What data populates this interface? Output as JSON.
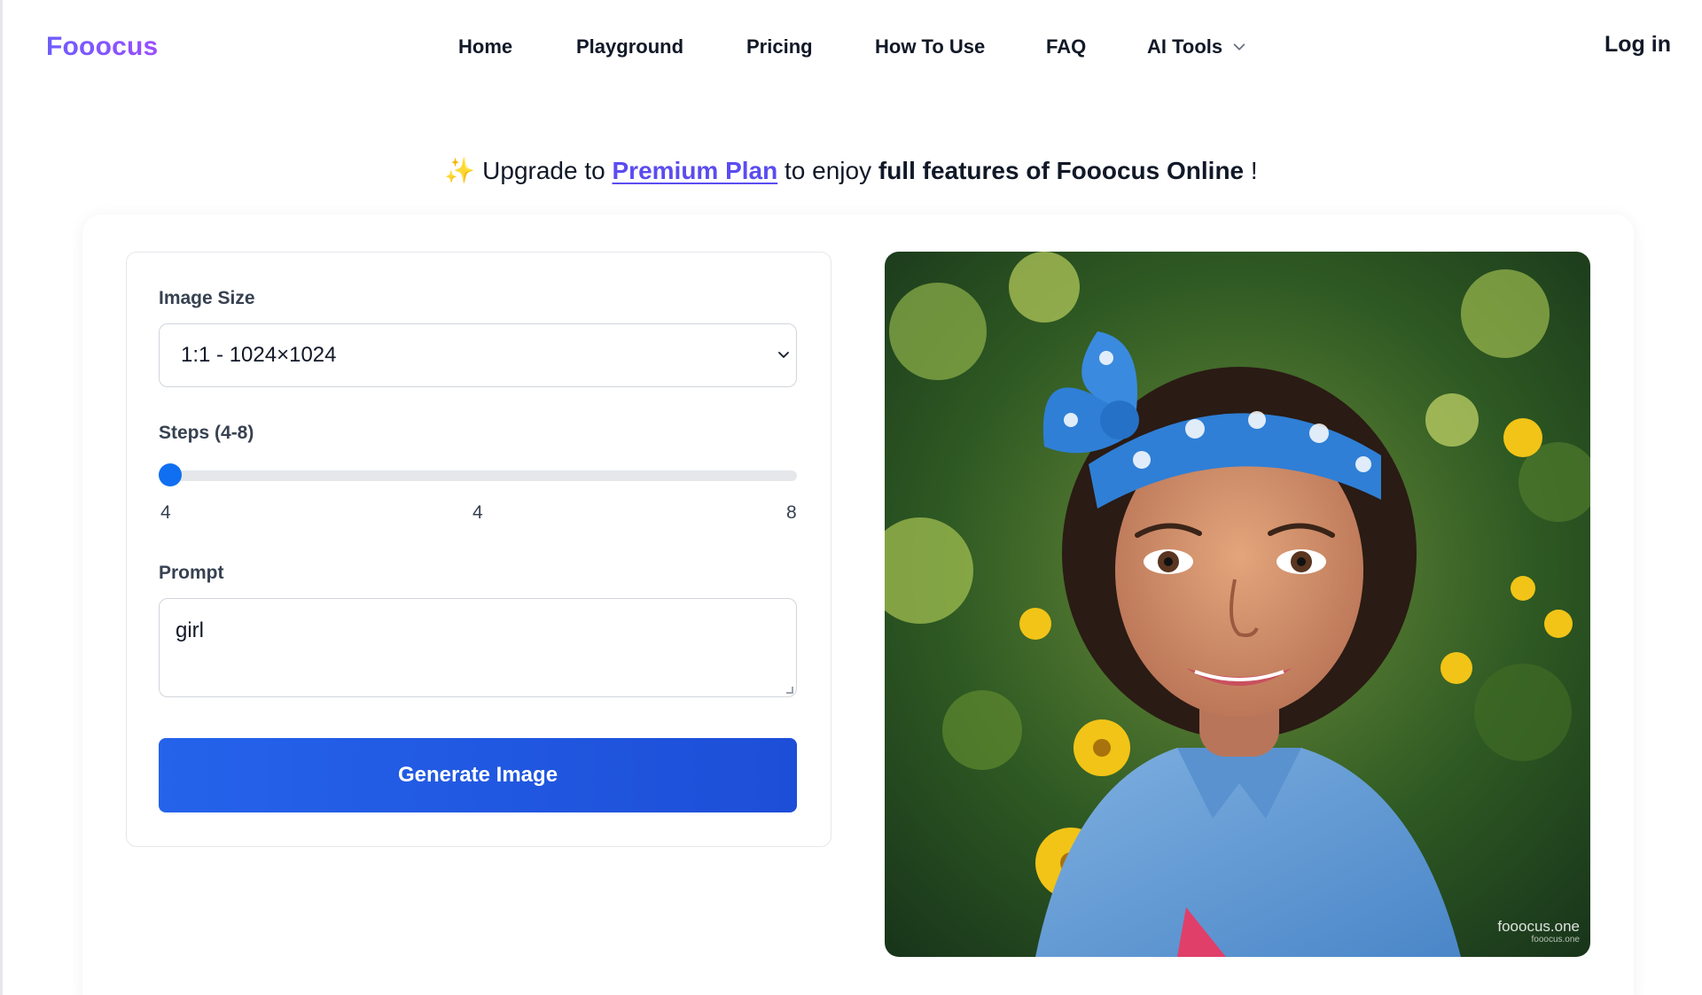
{
  "header": {
    "logo": "Fooocus",
    "nav": [
      {
        "label": "Home"
      },
      {
        "label": "Playground"
      },
      {
        "label": "Pricing"
      },
      {
        "label": "How To Use"
      },
      {
        "label": "FAQ"
      },
      {
        "label": "AI Tools"
      }
    ],
    "login": "Log in"
  },
  "banner": {
    "sparkle": "✨",
    "prefix": "Upgrade to",
    "link": "Premium Plan",
    "middle": "to enjoy",
    "bold": "full features of Fooocus Online",
    "suffix": "!"
  },
  "form": {
    "image_size_label": "Image Size",
    "image_size_value": "1:1 - 1024×1024",
    "steps_label": "Steps (4-8)",
    "steps_min": "4",
    "steps_value": "4",
    "steps_max": "8",
    "prompt_label": "Prompt",
    "prompt_value": "girl",
    "generate_label": "Generate Image"
  },
  "image": {
    "watermark": "fooocus.one",
    "watermark_small": "fooocus.one"
  },
  "colors": {
    "accent": "#2563eb",
    "logo": "#7c4dff",
    "link": "#5b4cf0",
    "slider": "#0f6ff0"
  }
}
